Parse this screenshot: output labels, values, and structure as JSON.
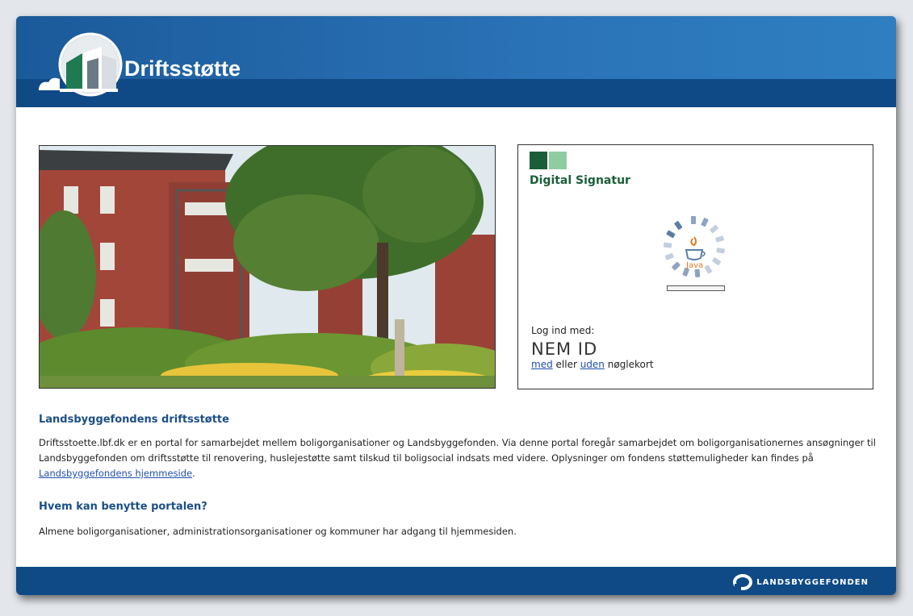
{
  "header": {
    "logo_text": "Driftsstøtte"
  },
  "login": {
    "brand_title": "Digital Signatur",
    "java_label": "Java",
    "login_with_label": "Log ind med:",
    "nemid_label": "NEM ID",
    "link_with": "med",
    "or_text": " eller ",
    "link_without": "uden",
    "keycard_text": " nøglekort"
  },
  "content": {
    "section1_title": "Landsbyggefondens driftsstøtte",
    "section1_text": "Driftsstoette.lbf.dk er en portal for samarbejdet mellem boligorganisationer og Landsbyggefonden. Via denne portal foregår samarbejdet om boligorganisationernes ansøgninger til Landsbyggefonden om driftsstøtte til renovering, huslejestøtte samt tilskud til boligsocial indsats med videre. Oplysninger om fondens støttemuligheder kan findes på ",
    "section1_link": "Landsbyggefondens hjemmeside",
    "section1_end": ".",
    "section2_title": "Hvem kan benytte portalen?",
    "section2_text": "Almene boligorganisationer, administrationsorganisationer og kommuner har adgang til hjemmesiden."
  },
  "footer": {
    "brand": "LANDSBYGGEFONDEN"
  },
  "colors": {
    "header_blue": "#0f4a87",
    "heading_blue": "#1b4f86",
    "link_blue": "#1f4fb0",
    "ds_green": "#1a5e37"
  },
  "icons": {
    "logo": "driftsstotte-logo-icon",
    "ds": "digital-signatur-logo-icon",
    "java": "java-loading-icon",
    "footer": "landsbyggefonden-logo-icon"
  }
}
